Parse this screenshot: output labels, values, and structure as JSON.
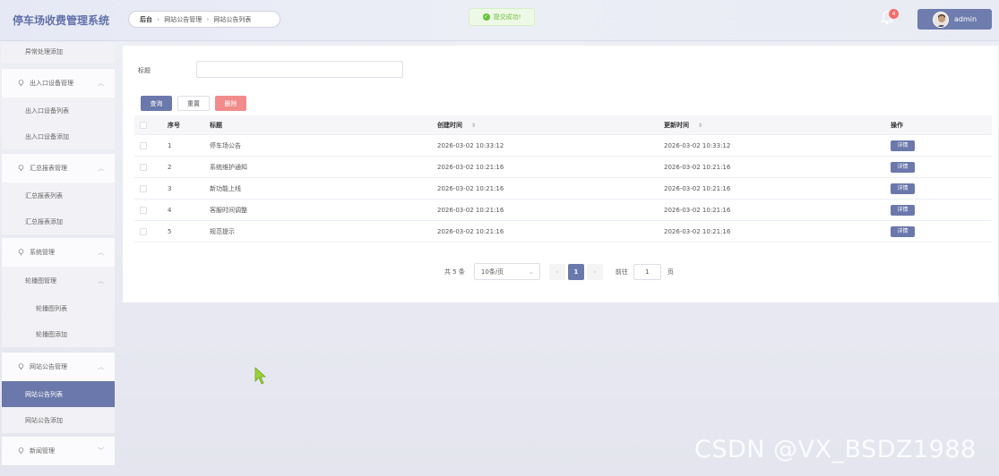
{
  "header": {
    "app_title": "停车场收费管理系统",
    "breadcrumb": [
      "后台",
      "网站公告管理",
      "网站公告列表"
    ],
    "toast": "提交成功!",
    "notification_count": "4",
    "user_name": "admin"
  },
  "sidebar": {
    "top_item": "异常处理添加",
    "group_1": {
      "label": "出入口设备管理",
      "items": [
        "出入口设备列表",
        "出入口设备添加"
      ]
    },
    "group_2": {
      "label": "汇总报表管理",
      "items": [
        "汇总报表列表",
        "汇总报表添加"
      ]
    },
    "group_3": {
      "label": "系统管理",
      "sub_label": "轮播图管理",
      "items": [
        "轮播图列表",
        "轮播图添加"
      ]
    },
    "group_4": {
      "label": "网站公告管理",
      "items": [
        "网站公告列表",
        "网站公告添加"
      ]
    },
    "group_5": {
      "label": "新闻管理"
    }
  },
  "filter": {
    "title_label": "标题",
    "title_value": ""
  },
  "buttons": {
    "query": "查询",
    "reset": "重置",
    "delete": "删除"
  },
  "table": {
    "headers": {
      "no": "序号",
      "title": "标题",
      "created": "创建时间",
      "updated": "更新时间",
      "op": "操作"
    },
    "rows": [
      {
        "no": "1",
        "title": "停车场公告",
        "created": "2026-03-02 10:33:12",
        "updated": "2026-03-02 10:33:12",
        "op": "详情"
      },
      {
        "no": "2",
        "title": "系统维护通知",
        "created": "2026-03-02 10:21:16",
        "updated": "2026-03-02 10:21:16",
        "op": "详情"
      },
      {
        "no": "3",
        "title": "新功能上线",
        "created": "2026-03-02 10:21:16",
        "updated": "2026-03-02 10:21:16",
        "op": "详情"
      },
      {
        "no": "4",
        "title": "客服时间调整",
        "created": "2026-03-02 10:21:16",
        "updated": "2026-03-02 10:21:16",
        "op": "详情"
      },
      {
        "no": "5",
        "title": "规范提示",
        "created": "2026-03-02 10:21:16",
        "updated": "2026-03-02 10:21:16",
        "op": "详情"
      }
    ]
  },
  "pagination": {
    "total": "共 5 条",
    "page_size": "10条/页",
    "current_page": "1",
    "goto_label": "前往",
    "goto_value": "1",
    "page_suffix": "页"
  },
  "watermark": "CSDN @VX_BSDZ1988"
}
